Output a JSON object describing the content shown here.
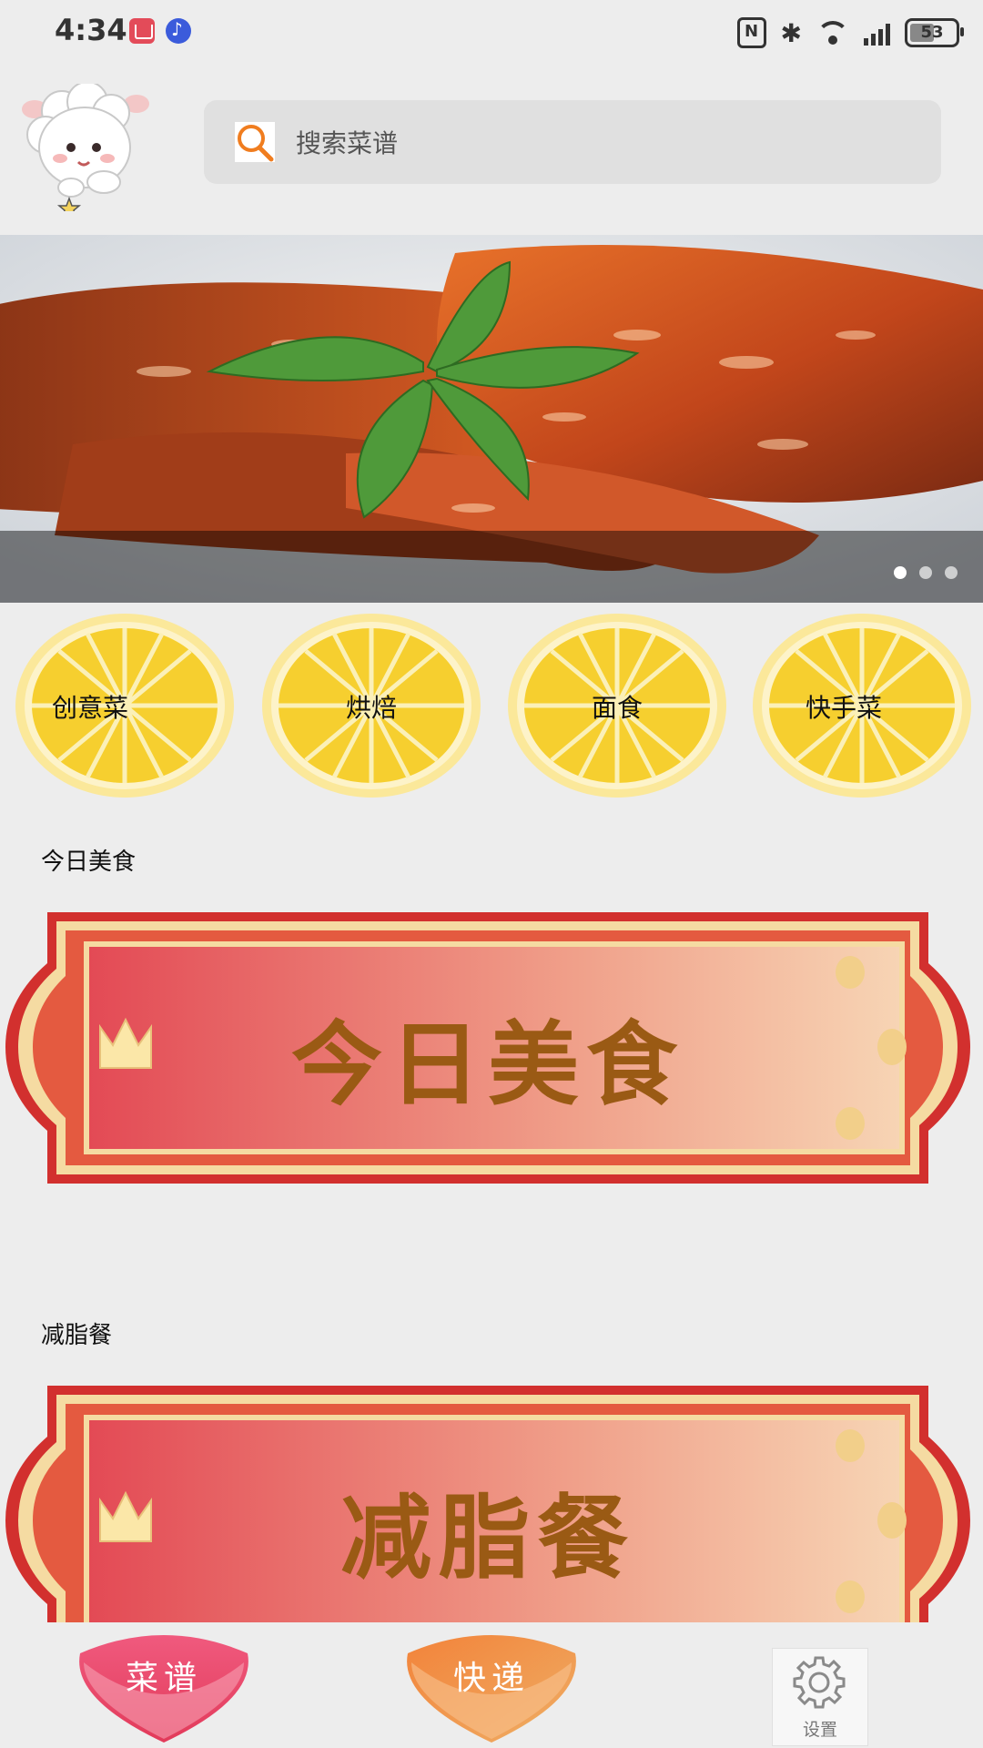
{
  "status_bar": {
    "time": "4:34",
    "battery": "53",
    "network": "4G"
  },
  "header": {
    "search_placeholder": "搜索菜谱"
  },
  "banner": {
    "slides": 3,
    "active_slide": 1
  },
  "categories": [
    "创意菜",
    "烘焙",
    "面食",
    "快手菜"
  ],
  "sections": [
    {
      "title": "今日美食",
      "banner_text": "今日美食"
    },
    {
      "title": "减脂餐",
      "banner_text": "减脂餐"
    }
  ],
  "bottom_nav": {
    "recipes": "菜谱",
    "delivery": "快递",
    "settings": "设置"
  },
  "colors": {
    "accent_pink": "#e8456b",
    "accent_orange": "#f2833a",
    "lemon": "#f6cf2f"
  }
}
